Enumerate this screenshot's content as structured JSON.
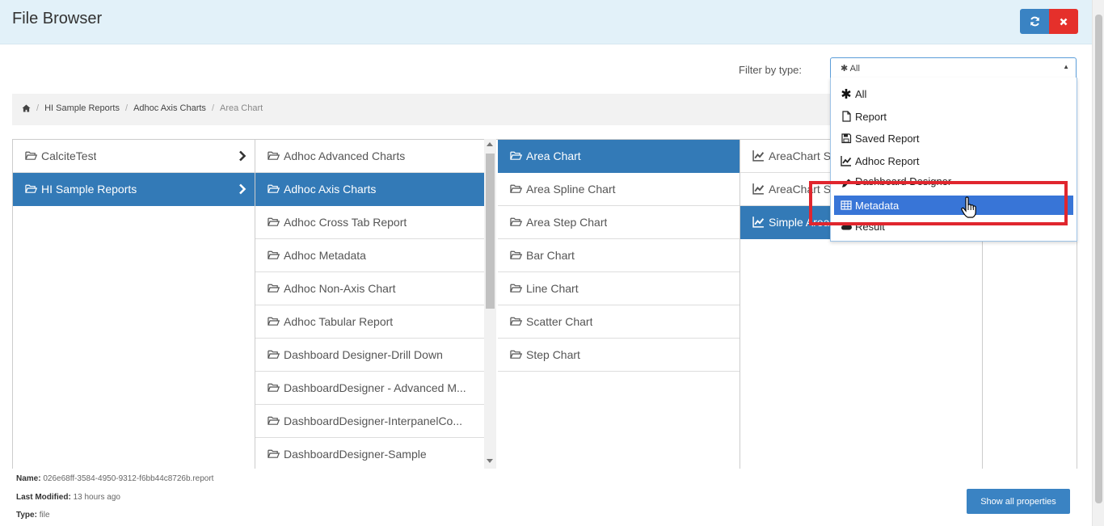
{
  "header": {
    "title": "File Browser"
  },
  "filter": {
    "label": "Filter by type:",
    "selected": "All",
    "options": [
      {
        "label": "All",
        "icon": "asterisk-icon"
      },
      {
        "label": "Report",
        "icon": "file-icon"
      },
      {
        "label": "Saved Report",
        "icon": "floppy-icon"
      },
      {
        "label": "Adhoc Report",
        "icon": "line-chart-icon"
      },
      {
        "label": "Dashboard Designer",
        "icon": "pencil-icon"
      },
      {
        "label": "Metadata",
        "icon": "table-icon"
      },
      {
        "label": "Result",
        "icon": "cloud-icon"
      }
    ],
    "highlighted": "Metadata"
  },
  "breadcrumb": {
    "items": [
      "HI Sample Reports",
      "Adhoc Axis Charts",
      "Area Chart"
    ]
  },
  "columns": [
    {
      "items": [
        "CalciteTest",
        "HI Sample Reports"
      ],
      "selected": 1
    },
    {
      "items": [
        "Adhoc Advanced Charts",
        "Adhoc Axis Charts",
        "Adhoc Cross Tab Report",
        "Adhoc Metadata",
        "Adhoc Non-Axis Chart",
        "Adhoc Tabular Report",
        "Dashboard Designer-Drill Down",
        "DashboardDesigner - Advanced M...",
        "DashboardDesigner-InterpanelCo...",
        "DashboardDesigner-Sample"
      ],
      "selected": 1
    },
    {
      "items": [
        "Area Chart",
        "Area Spline Chart",
        "Area Step Chart",
        "Bar Chart",
        "Line Chart",
        "Scatter Chart",
        "Step Chart"
      ],
      "selected": 0
    },
    {
      "items": [
        "AreaChart S",
        "AreaChart S",
        "Simple Area"
      ],
      "selected": 2
    }
  ],
  "details": {
    "name_label": "Name:",
    "name": "026e68ff-3584-4950-9312-f6bb44c8726b.report",
    "modified_label": "Last Modified:",
    "modified": "13 hours ago",
    "type_label": "Type:",
    "type": "file"
  },
  "buttons": {
    "show_props": "Show all properties"
  },
  "colors": {
    "accent": "#337ab7",
    "danger": "#e5302b",
    "highlight": "#3875d7",
    "annotation": "#e0262e"
  }
}
